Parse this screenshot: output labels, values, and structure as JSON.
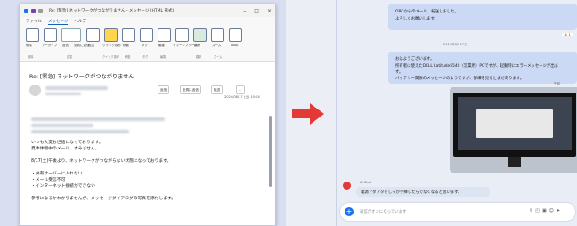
{
  "outlook": {
    "title": "Re: [緊急] ネットワークがつながりません - メッセージ (HTML 形式)",
    "menu": [
      "ファイル",
      "メッセージ",
      "ヘルプ"
    ],
    "ribbon_labels": [
      "削除",
      "アーカイブ",
      "返信",
      "全員に返信",
      "転送",
      "クイック操作",
      "移動",
      "タグ",
      "編集",
      "イマーシブリーダー",
      "翻訳",
      "ズーム",
      "Loop"
    ],
    "groups": [
      "削除",
      "応答",
      "クイック操作",
      "移動",
      "タグ",
      "編集",
      "翻訳",
      "ズーム"
    ],
    "subject": "Re: [緊急] ネットワークがつながりません",
    "actions": [
      "返信",
      "全員に返信",
      "転送"
    ],
    "date": "2024/08/17 (土) 10:04",
    "body": [
      "いつも大変お世話になっております。",
      "夏季休暇中のメール、すみません。",
      "8/17(土)午後より、ネットワークがつながらない状態になっております。",
      "・共有サーバーに入れない",
      "・メール受信不可",
      "・インターネット接続ができない",
      "参考になるかわかりませんが、メッセージダイアログの写真を添付します。"
    ]
  },
  "chat": {
    "msg1": [
      "OBCからのメール、転送しました。",
      "よろしくお願いします。"
    ],
    "reaction": "👍 1",
    "date_sep": "2024年8月17日",
    "msg2": [
      "おはようございます。",
      "所有者に使えたDELL Latitude5540（営業用）PCですが、起動時にエラーメッセージが出ま",
      "す。",
      "バッテリー関係のメッセージのようですが、詳細を見るとまだあります。"
    ],
    "photo_time": "午前",
    "footer_name": "AI Chat",
    "footer_reply": "電源アダプタをしっかり挿したらでなくなると思います。",
    "placeholder": "返信がオンになっています"
  },
  "colors": {
    "arrow": "#e53935",
    "bubble": "#cbd9f4",
    "accent": "#1a73e8"
  }
}
